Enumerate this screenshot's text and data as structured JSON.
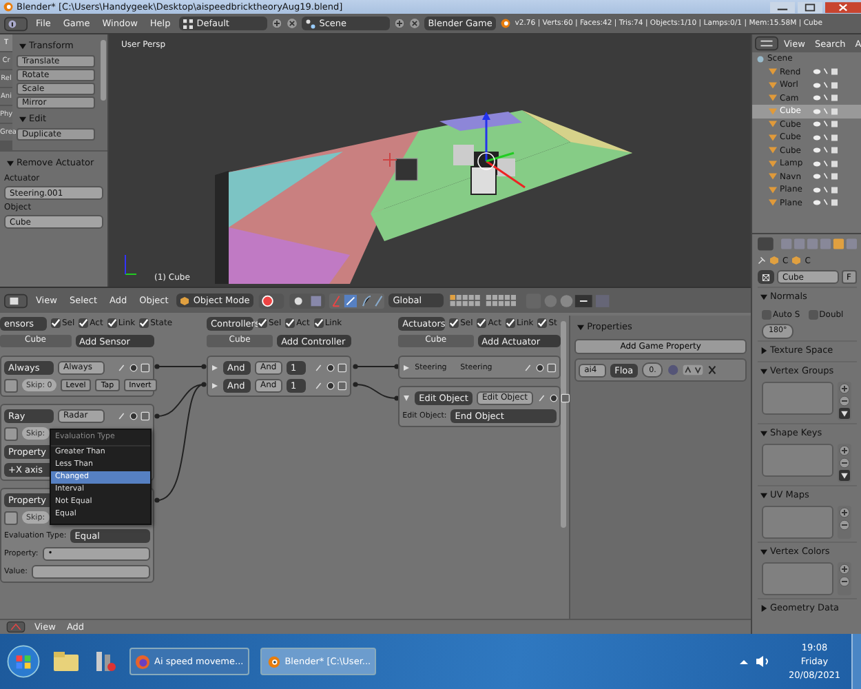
{
  "window": {
    "title": "Blender* [C:\\Users\\Handygeek\\Desktop\\aispeedbricktheoryAug19.blend]"
  },
  "menu_bar": {
    "menus": [
      "File",
      "Game",
      "Window",
      "Help"
    ],
    "layout": "Default",
    "scene": "Scene",
    "engine": "Blender Game",
    "stats": "v2.76 | Verts:60 | Faces:42 | Tris:74 | Objects:1/10 | Lamps:0/1 | Mem:15.58M | Cube"
  },
  "tool_shelf": {
    "tabs": [
      {
        "label": "T",
        "selected": true
      },
      {
        "label": "Cr",
        "selected": false
      },
      {
        "label": "Rel",
        "selected": false
      },
      {
        "label": "Ani",
        "selected": false
      },
      {
        "label": "Phy",
        "selected": false
      },
      {
        "label": "Grea",
        "selected": false
      }
    ],
    "panels": [
      {
        "title": "Transform",
        "expanded": true,
        "buttons": [
          "Translate",
          "Rotate",
          "Scale",
          "Mirror"
        ]
      },
      {
        "title": "Edit",
        "expanded": true,
        "buttons": [
          "Duplicate"
        ]
      }
    ]
  },
  "operator_panel": {
    "title": "Remove Actuator",
    "fields": [
      {
        "label": "Actuator",
        "value": "Steering.001"
      },
      {
        "label": "Object",
        "value": "Cube"
      }
    ]
  },
  "viewport": {
    "view_label": "User Persp",
    "object_label": "(1) Cube"
  },
  "outliner": {
    "menus": [
      "View",
      "Search",
      "A"
    ],
    "items": [
      {
        "name": "Scene",
        "selected": false,
        "children": [
          {
            "name": "Rend",
            "selected": false
          },
          {
            "name": "Worl",
            "selected": false
          },
          {
            "name": "Cam",
            "selected": false
          },
          {
            "name": "Cube",
            "selected": true
          },
          {
            "name": "Cube",
            "selected": false
          },
          {
            "name": "Cube",
            "selected": false
          },
          {
            "name": "Cube",
            "selected": false
          },
          {
            "name": "Lamp",
            "selected": false
          },
          {
            "name": "Navn",
            "selected": false
          },
          {
            "name": "Plane",
            "selected": false
          },
          {
            "name": "Plane",
            "selected": false
          }
        ]
      }
    ]
  },
  "properties": {
    "breadcrumb": [
      "C",
      "C"
    ],
    "object_name": "Cube",
    "fake_user": "F",
    "panels": [
      {
        "title": "Normals",
        "expanded": true,
        "kind": "normals",
        "checkboxes": [
          {
            "label": "Auto S",
            "checked": false
          },
          {
            "label": "Doubl",
            "checked": false
          }
        ],
        "angle": "180°"
      },
      {
        "title": "Texture Space",
        "expanded": false
      },
      {
        "title": "Vertex Groups",
        "expanded": true,
        "kind": "list",
        "has_menu": true
      },
      {
        "title": "Shape Keys",
        "expanded": true,
        "kind": "list",
        "has_menu": true
      },
      {
        "title": "UV Maps",
        "expanded": true,
        "kind": "list",
        "has_menu": false
      },
      {
        "title": "Vertex Colors",
        "expanded": true,
        "kind": "list",
        "has_menu": false
      },
      {
        "title": "Geometry Data",
        "expanded": false
      }
    ]
  },
  "logic_header": {
    "menus": [
      "View",
      "Select",
      "Add",
      "Object"
    ],
    "mode": "Object Mode",
    "orientation": "Global"
  },
  "sensors": {
    "header": "ensors",
    "options": [
      {
        "label": "Sel",
        "checked": true
      },
      {
        "label": "Act",
        "checked": true
      },
      {
        "label": "Link",
        "checked": true
      },
      {
        "label": "State",
        "checked": true
      }
    ],
    "object": "Cube",
    "add": "Add Sensor",
    "items": [
      {
        "kind": "always",
        "type": "Always",
        "name": "Always",
        "skip_label": "Skip:",
        "skip": "0",
        "buttons": [
          "Level",
          "Tap",
          "Invert"
        ]
      },
      {
        "kind": "ray",
        "type": "Ray",
        "name": "Radar",
        "skip_label": "Skip:",
        "property_type": "Property",
        "axis": "+X axis"
      },
      {
        "kind": "property",
        "type": "Property",
        "skip_label": "Skip:",
        "fields": [
          {
            "label": "Evaluation Type:",
            "value": "Equal",
            "kind": "dropdown"
          },
          {
            "label": "Property:",
            "value": "•",
            "kind": "text"
          },
          {
            "label": "Value:",
            "kind": "text"
          }
        ]
      }
    ]
  },
  "evaluation_menu": {
    "title": "Evaluation Type",
    "items": [
      {
        "label": "Greater Than",
        "selected": false
      },
      {
        "label": "Less Than",
        "selected": false
      },
      {
        "label": "Changed",
        "selected": true
      },
      {
        "label": "Interval",
        "selected": false
      },
      {
        "label": "Not Equal",
        "selected": false
      },
      {
        "label": "Equal",
        "selected": false
      }
    ]
  },
  "controllers": {
    "header": "Controllers",
    "options": [
      {
        "label": "Sel",
        "checked": true
      },
      {
        "label": "Act",
        "checked": true
      },
      {
        "label": "Link",
        "checked": true
      }
    ],
    "object": "Cube",
    "add": "Add Controller",
    "items": [
      {
        "type": "And",
        "name": "And",
        "state": "1"
      },
      {
        "type": "And",
        "name": "And",
        "state": "1"
      }
    ]
  },
  "actuators": {
    "header": "Actuators",
    "options": [
      {
        "label": "Sel",
        "checked": true
      },
      {
        "label": "Act",
        "checked": true
      },
      {
        "label": "Link",
        "checked": true
      },
      {
        "label": "St",
        "checked": true
      }
    ],
    "object": "Cube",
    "add": "Add Actuator",
    "items": [
      {
        "type": "Steering",
        "name": "Steering",
        "expanded": false
      },
      {
        "type": "Edit Object",
        "name": "Edit Object",
        "expanded": true,
        "field_label": "Edit Object:",
        "field_value": "End Object"
      }
    ]
  },
  "game_properties": {
    "title": "Properties",
    "add": "Add Game Property",
    "items": [
      {
        "name": "ai4",
        "type": "Floa",
        "value": "0."
      }
    ]
  },
  "logic_footer": {
    "menus": [
      "View",
      "Add"
    ]
  },
  "taskbar": {
    "tasks": [
      {
        "label": "Ai speed moveme...",
        "kind": "browser",
        "selected": false
      },
      {
        "label": "Blender* [C:\\User...",
        "kind": "blender",
        "selected": true
      }
    ],
    "time": "19:08",
    "day": "Friday",
    "date": "20/08/2021"
  }
}
